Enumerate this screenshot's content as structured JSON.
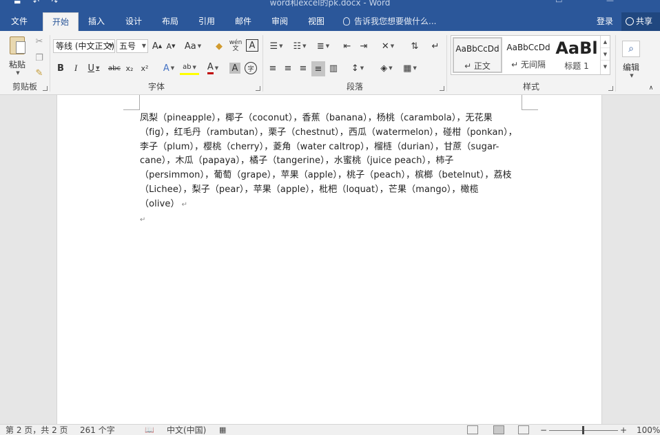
{
  "window": {
    "title": "word和excel的pk.docx - Word",
    "qat": [
      "save-icon",
      "undo-icon",
      "redo-icon"
    ]
  },
  "tabs": [
    "文件",
    "开始",
    "插入",
    "设计",
    "布局",
    "引用",
    "邮件",
    "审阅",
    "视图"
  ],
  "active_tab": "开始",
  "tell_me": "告诉我您想要做什么...",
  "account": {
    "login": "登录",
    "share": "共享"
  },
  "ribbon": {
    "clipboard": {
      "paste": "粘贴",
      "label": "剪贴板"
    },
    "font": {
      "label": "字体",
      "font_name": "等线 (中文正文)",
      "font_size": "五号",
      "grow": "A",
      "shrink": "A",
      "case": "Aa",
      "phonetic": "wén",
      "border_char": "A",
      "bold": "B",
      "italic": "I",
      "underline": "U",
      "strike": "abc",
      "subscript": "x₂",
      "superscript": "x²",
      "text_effect": "A",
      "highlight": "ab",
      "font_color": "A",
      "shading": "A",
      "enclose": "字"
    },
    "paragraph": {
      "label": "段落"
    },
    "styles": {
      "label": "样式",
      "items": [
        {
          "sample": "AaBbCcDd",
          "name": "↵ 正文"
        },
        {
          "sample": "AaBbCcDd",
          "name": "↵ 无间隔"
        },
        {
          "sample": "AaBl",
          "name": "标题 1"
        }
      ]
    },
    "editing": {
      "label": "编辑"
    }
  },
  "document": {
    "lines": [
      "凤梨（pineapple），椰子（coconut），香蕉（banana），杨桃（carambola），无花果",
      "（fig），红毛丹（rambutan），栗子（chestnut），西瓜（watermelon），碰柑（ponkan），",
      "李子（plum），樱桃（cherry），菱角（water caltrop），榴梿（durian），甘蔗（sugar-",
      "cane），木瓜（papaya），橘子（tangerine），水蜜桃（juice peach），柿子",
      "（persimmon），葡萄（grape），苹果（apple），桃子（peach），槟榔（betelnut），荔枝",
      "（Lichee），梨子（pear），苹果（apple），枇杷（loquat），芒果（mango），橄榄",
      "（olive）"
    ],
    "paragraph_mark": "↵"
  },
  "status": {
    "page": "第 2 页，共 2 页",
    "words": "261 个字",
    "language": "中文(中国)",
    "zoom": "100%"
  }
}
